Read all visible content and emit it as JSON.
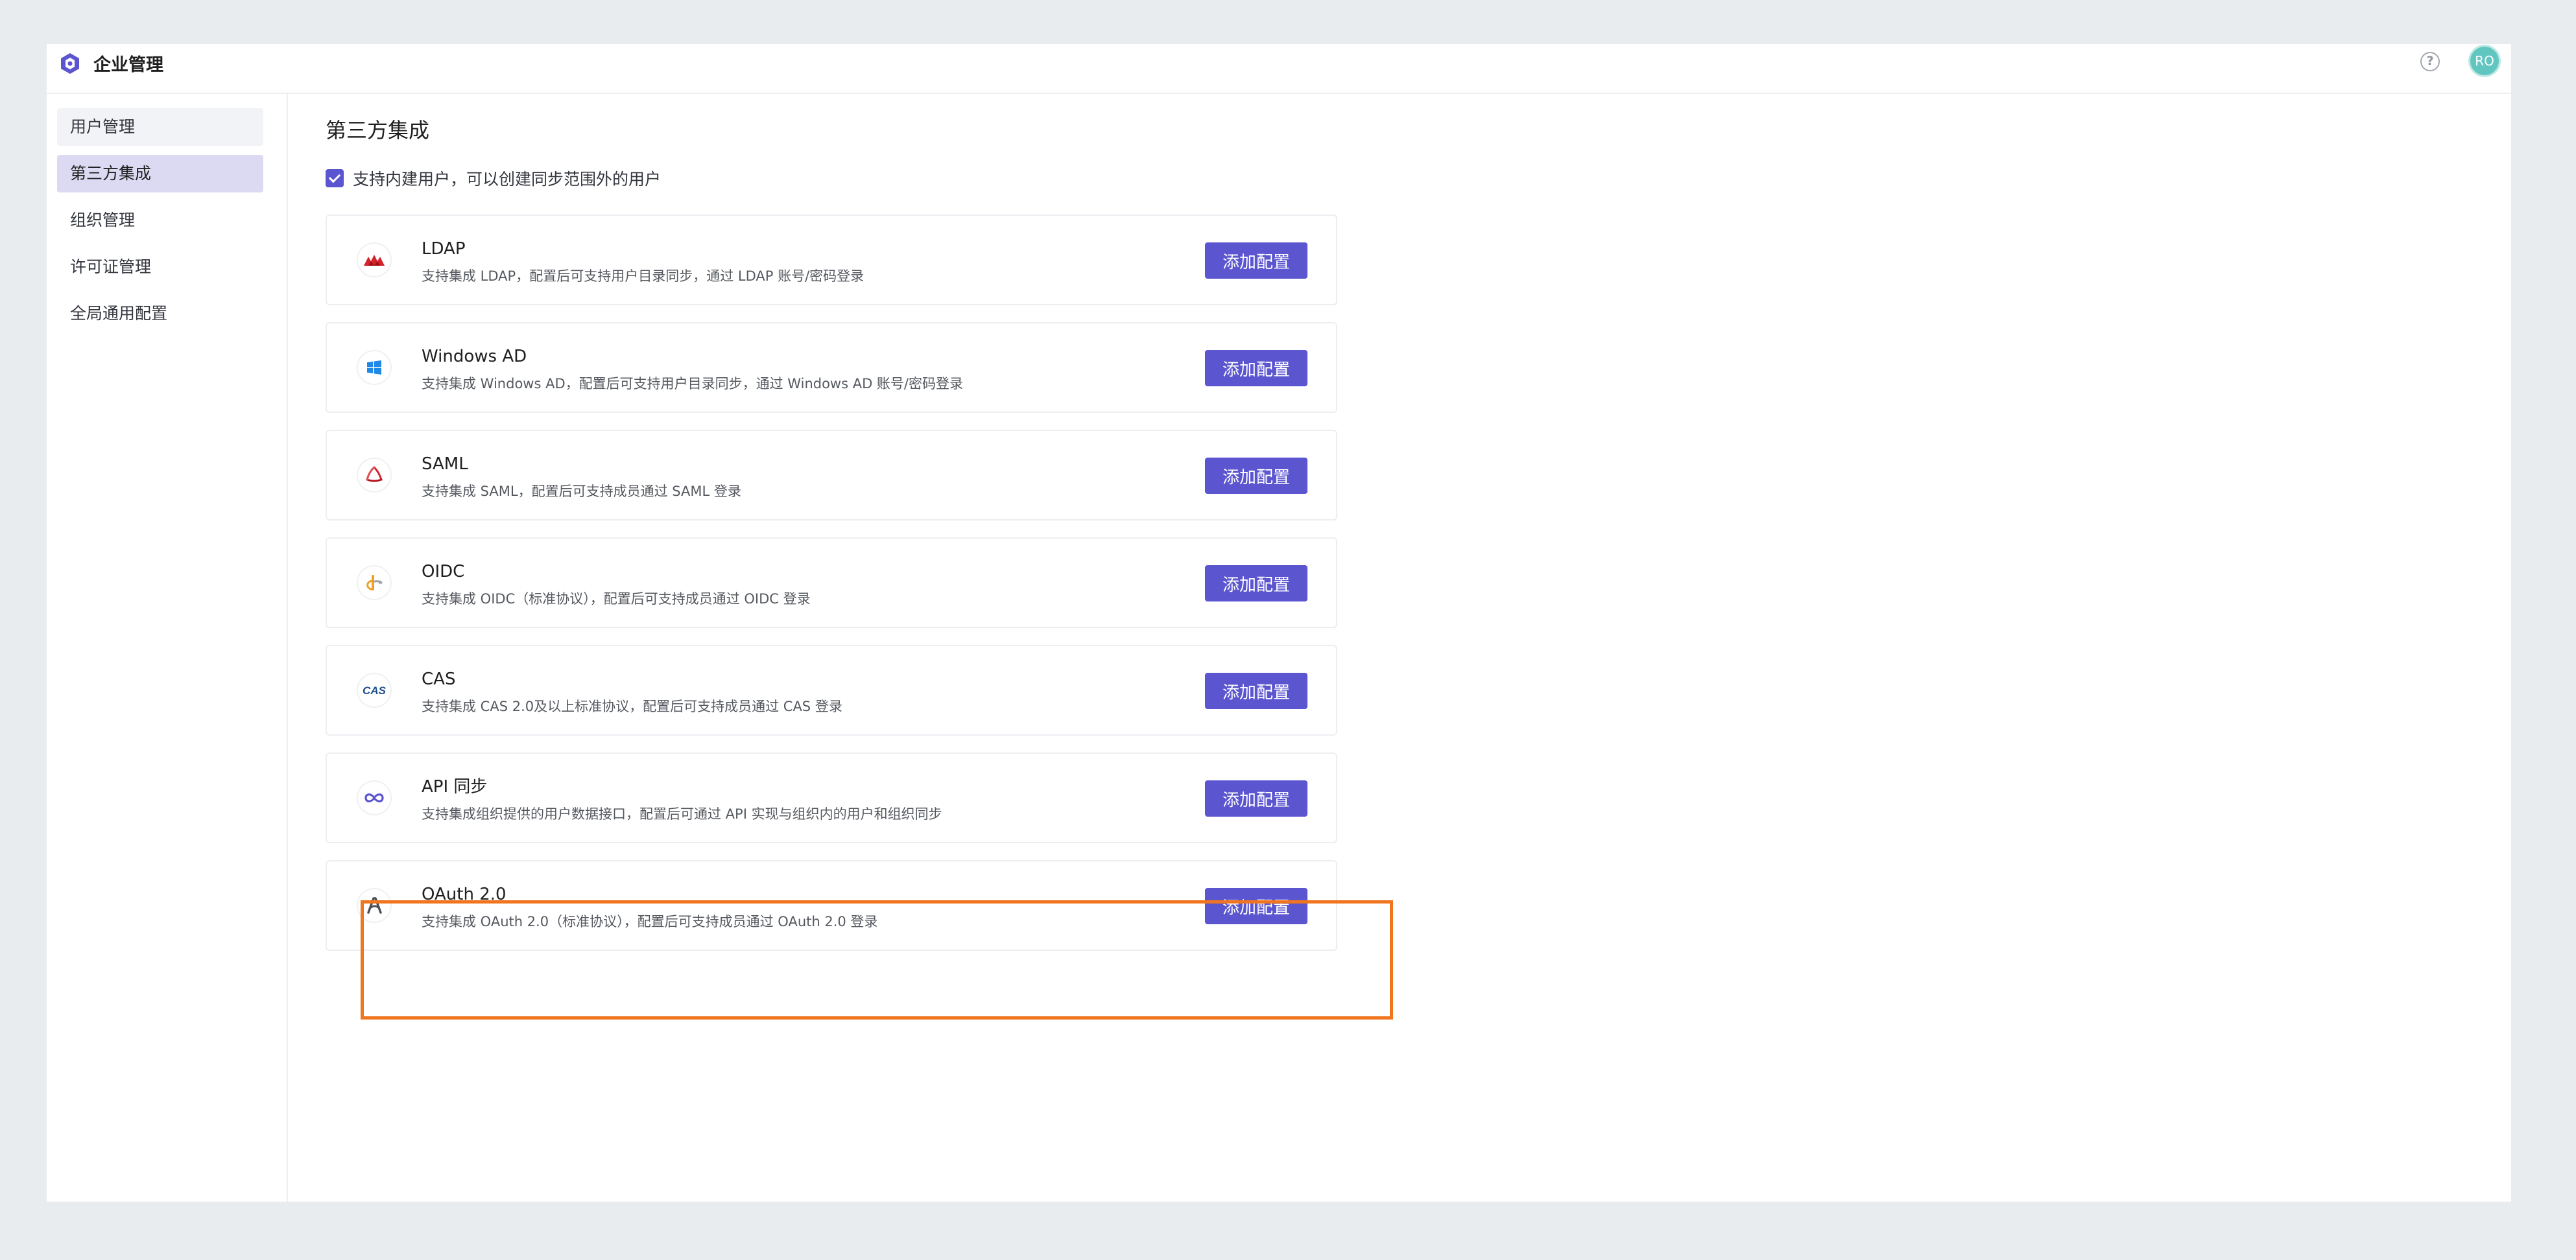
{
  "header": {
    "app_title": "企业管理",
    "logo_icon": "hexagon-logo-icon",
    "help_icon_glyph": "?",
    "avatar_initials": "RO",
    "avatar_color": "#61c6c0"
  },
  "sidebar": {
    "items": [
      {
        "label": "用户管理",
        "state": "hover"
      },
      {
        "label": "第三方集成",
        "state": "active"
      },
      {
        "label": "组织管理",
        "state": "normal"
      },
      {
        "label": "许可证管理",
        "state": "normal"
      },
      {
        "label": "全局通用配置",
        "state": "normal"
      }
    ]
  },
  "main": {
    "title": "第三方集成",
    "checkbox": {
      "checked": true,
      "label": "支持内建用户，可以创建同步范围外的用户"
    },
    "integrations": [
      {
        "name": "LDAP",
        "description": "支持集成 LDAP，配置后可支持用户目录同步，通过 LDAP 账号/密码登录",
        "icon": "ldap-icon",
        "button": "添加配置"
      },
      {
        "name": "Windows AD",
        "description": "支持集成 Windows AD，配置后可支持用户目录同步，通过 Windows AD 账号/密码登录",
        "icon": "windows-icon",
        "button": "添加配置"
      },
      {
        "name": "SAML",
        "description": "支持集成 SAML，配置后可支持成员通过 SAML 登录",
        "icon": "saml-icon",
        "button": "添加配置"
      },
      {
        "name": "OIDC",
        "description": "支持集成 OIDC（标准协议），配置后可支持成员通过 OIDC 登录",
        "icon": "oidc-icon",
        "button": "添加配置"
      },
      {
        "name": "CAS",
        "description": "支持集成 CAS 2.0及以上标准协议，配置后可支持成员通过 CAS 登录",
        "icon": "cas-icon",
        "button": "添加配置"
      },
      {
        "name": "API 同步",
        "description": "支持集成组织提供的用户数据接口，配置后可通过 API 实现与组织内的用户和组织同步",
        "icon": "infinity-icon",
        "button": "添加配置"
      },
      {
        "name": "OAuth 2.0",
        "description": "支持集成 OAuth 2.0（标准协议），配置后可支持成员通过 OAuth 2.0 登录",
        "icon": "oauth-icon",
        "button": "添加配置",
        "highlighted": true
      }
    ]
  },
  "colors": {
    "accent": "#5b55cf",
    "active_nav_bg": "#dcdaf3",
    "highlight_border": "#f0751f",
    "page_bg": "#e9ecef"
  }
}
